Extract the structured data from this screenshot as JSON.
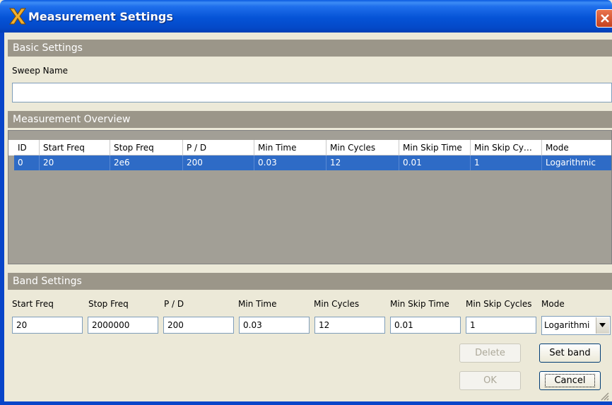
{
  "window": {
    "title": "Measurement Settings"
  },
  "basic_settings": {
    "header": "Basic Settings",
    "sweep_name_label": "Sweep Name",
    "sweep_name_value": ""
  },
  "overview": {
    "header": "Measurement Overview",
    "columns": [
      "ID",
      "Start Freq",
      "Stop Freq",
      "P / D",
      "Min Time",
      "Min Cycles",
      "Min Skip Time",
      "Min Skip Cy…",
      "Mode"
    ],
    "rows": [
      [
        "0",
        "20",
        "2e6",
        "200",
        "0.03",
        "12",
        "0.01",
        "1",
        "Logarithmic"
      ]
    ]
  },
  "band_settings": {
    "header": "Band Settings",
    "fields": [
      {
        "label": "Start Freq",
        "value": "20"
      },
      {
        "label": "Stop Freq",
        "value": "2000000"
      },
      {
        "label": "P / D",
        "value": "200"
      },
      {
        "label": "Min Time",
        "value": "0.03"
      },
      {
        "label": "Min Cycles",
        "value": "12"
      },
      {
        "label": "Min Skip Time",
        "value": "0.01"
      },
      {
        "label": "Min Skip Cycles",
        "value": "1"
      }
    ],
    "mode_label": "Mode",
    "mode_value": "Logarithmi"
  },
  "buttons": {
    "delete": "Delete",
    "set_band": "Set band",
    "ok": "OK",
    "cancel": "Cancel"
  },
  "colors": {
    "titlebar": "#0553d6",
    "section_header": "#9b9689",
    "selection": "#2e6bc6",
    "dialog_bg": "#ece9d8"
  }
}
